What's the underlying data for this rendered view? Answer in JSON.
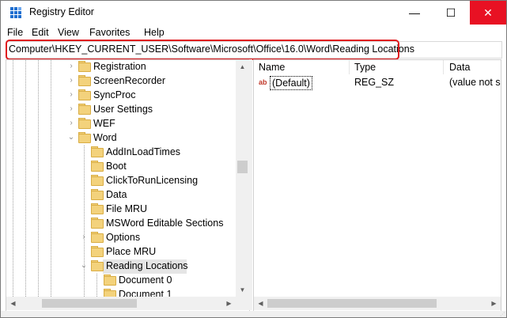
{
  "window": {
    "title": "Registry Editor",
    "icons": {
      "app": "registry-editor-icon",
      "minimize": "minimize-icon",
      "maximize": "maximize-icon",
      "close": "close-icon"
    },
    "minimize_glyph": "—",
    "maximize_glyph": "☐",
    "close_glyph": "✕",
    "close_color": "#e81123"
  },
  "menubar": {
    "items": [
      "File",
      "Edit",
      "View",
      "Favorites",
      "Help"
    ]
  },
  "address": {
    "path": "Computer\\HKEY_CURRENT_USER\\Software\\Microsoft\\Office\\16.0\\Word\\Reading Locations",
    "highlight_color": "#e0191d"
  },
  "tree": {
    "rows": [
      {
        "label": "Registration",
        "expander": "›",
        "expanded": false
      },
      {
        "label": "ScreenRecorder",
        "expander": "›",
        "expanded": false
      },
      {
        "label": "SyncProc",
        "expander": "›",
        "expanded": false
      },
      {
        "label": "User Settings",
        "expander": "›",
        "expanded": false
      },
      {
        "label": "WEF",
        "expander": "›",
        "expanded": false
      },
      {
        "label": "Word",
        "expander": "⌄",
        "expanded": true
      },
      {
        "label": "AddInLoadTimes",
        "expander": "",
        "expanded": false
      },
      {
        "label": "Boot",
        "expander": "",
        "expanded": false
      },
      {
        "label": "ClickToRunLicensing",
        "expander": "",
        "expanded": false
      },
      {
        "label": "Data",
        "expander": "",
        "expanded": false
      },
      {
        "label": "File MRU",
        "expander": "",
        "expanded": false
      },
      {
        "label": "MSWord Editable Sections",
        "expander": "",
        "expanded": false
      },
      {
        "label": "Options",
        "expander": "›",
        "expanded": false
      },
      {
        "label": "Place MRU",
        "expander": "",
        "expanded": false
      },
      {
        "label": "Reading Locations",
        "expander": "⌄",
        "expanded": true,
        "selected": true
      },
      {
        "label": "Document 0",
        "expander": "",
        "expanded": false
      },
      {
        "label": "Document 1",
        "expander": "",
        "expanded": false
      }
    ],
    "scroll_up": "▲",
    "scroll_down": "▼",
    "scroll_left": "◀",
    "scroll_right": "▶"
  },
  "list": {
    "columns": [
      "Name",
      "Type",
      "Data"
    ],
    "rows": [
      {
        "name": "(Default)",
        "type": "REG_SZ",
        "data": "(value not set)",
        "icon": "string-value-icon",
        "icon_glyph": "ab"
      }
    ],
    "scroll_left": "◀",
    "scroll_right": "▶"
  }
}
